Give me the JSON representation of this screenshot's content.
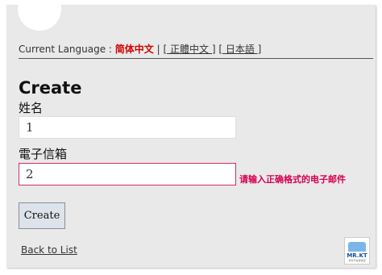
{
  "language_bar": {
    "prefix": "Current Language :",
    "current": "简体中文",
    "separator": "|",
    "options": [
      "[ 正體中文 ]",
      "[ 日本語 ]"
    ]
  },
  "form": {
    "title": "Create",
    "fields": [
      {
        "label": "姓名",
        "value": "1"
      },
      {
        "label": "電子信箱",
        "value": "2",
        "error": "请输入正确格式的电子邮件"
      }
    ],
    "submit_label": "Create"
  },
  "back_link": "Back to List",
  "logo": {
    "text": "MR.KT",
    "subtext": "软件开发者联盟"
  },
  "colors": {
    "error": "#d50050",
    "current_language": "#d50000"
  }
}
